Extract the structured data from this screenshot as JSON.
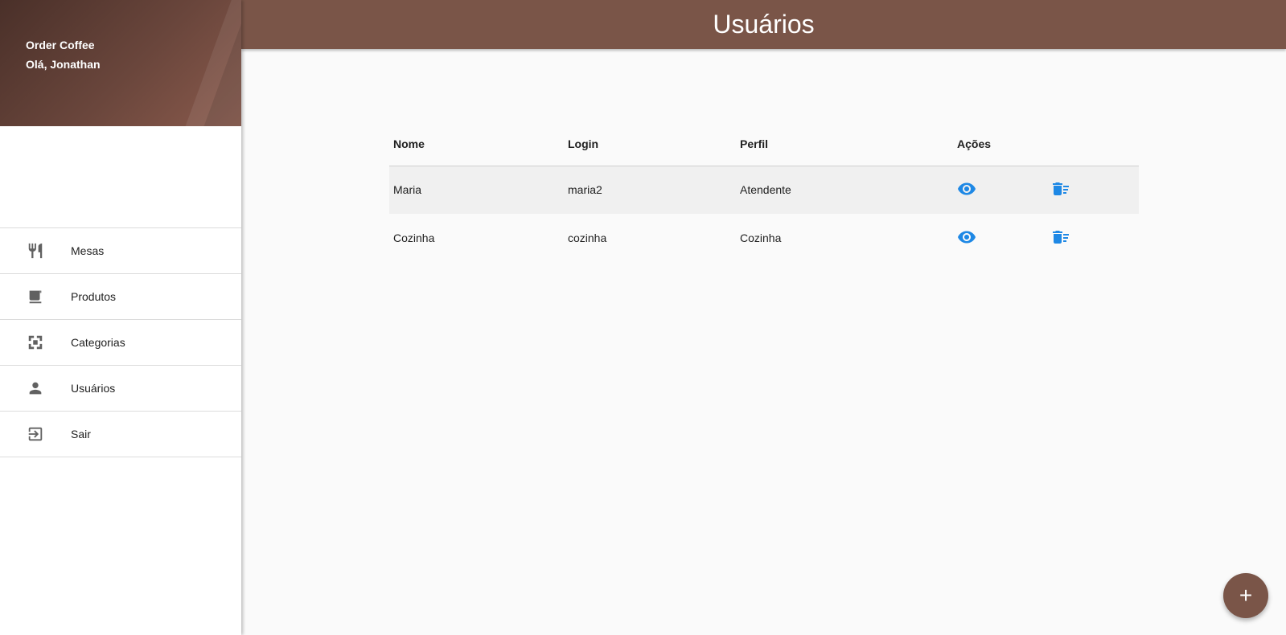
{
  "sidebar": {
    "app_name": "Order Coffee",
    "greeting": "Olá, Jonathan",
    "items": [
      {
        "label": "Mesas",
        "icon": "restaurant-icon"
      },
      {
        "label": "Produtos",
        "icon": "coffee-icon"
      },
      {
        "label": "Categorias",
        "icon": "category-frame-icon"
      },
      {
        "label": "Usuários",
        "icon": "person-icon"
      },
      {
        "label": "Sair",
        "icon": "exit-icon"
      }
    ]
  },
  "header": {
    "title": "Usuários"
  },
  "table": {
    "columns": [
      "Nome",
      "Login",
      "Perfil",
      "Ações"
    ],
    "rows": [
      {
        "nome": "Maria",
        "login": "maria2",
        "perfil": "Atendente"
      },
      {
        "nome": "Cozinha",
        "login": "cozinha",
        "perfil": "Cozinha"
      }
    ]
  },
  "fab": {
    "label": "+"
  },
  "colors": {
    "primary": "#7a5548",
    "action": "#1e88e5",
    "sidebar_gradient_dark": "#4a3029",
    "sidebar_gradient_light": "#8a5a4c"
  }
}
